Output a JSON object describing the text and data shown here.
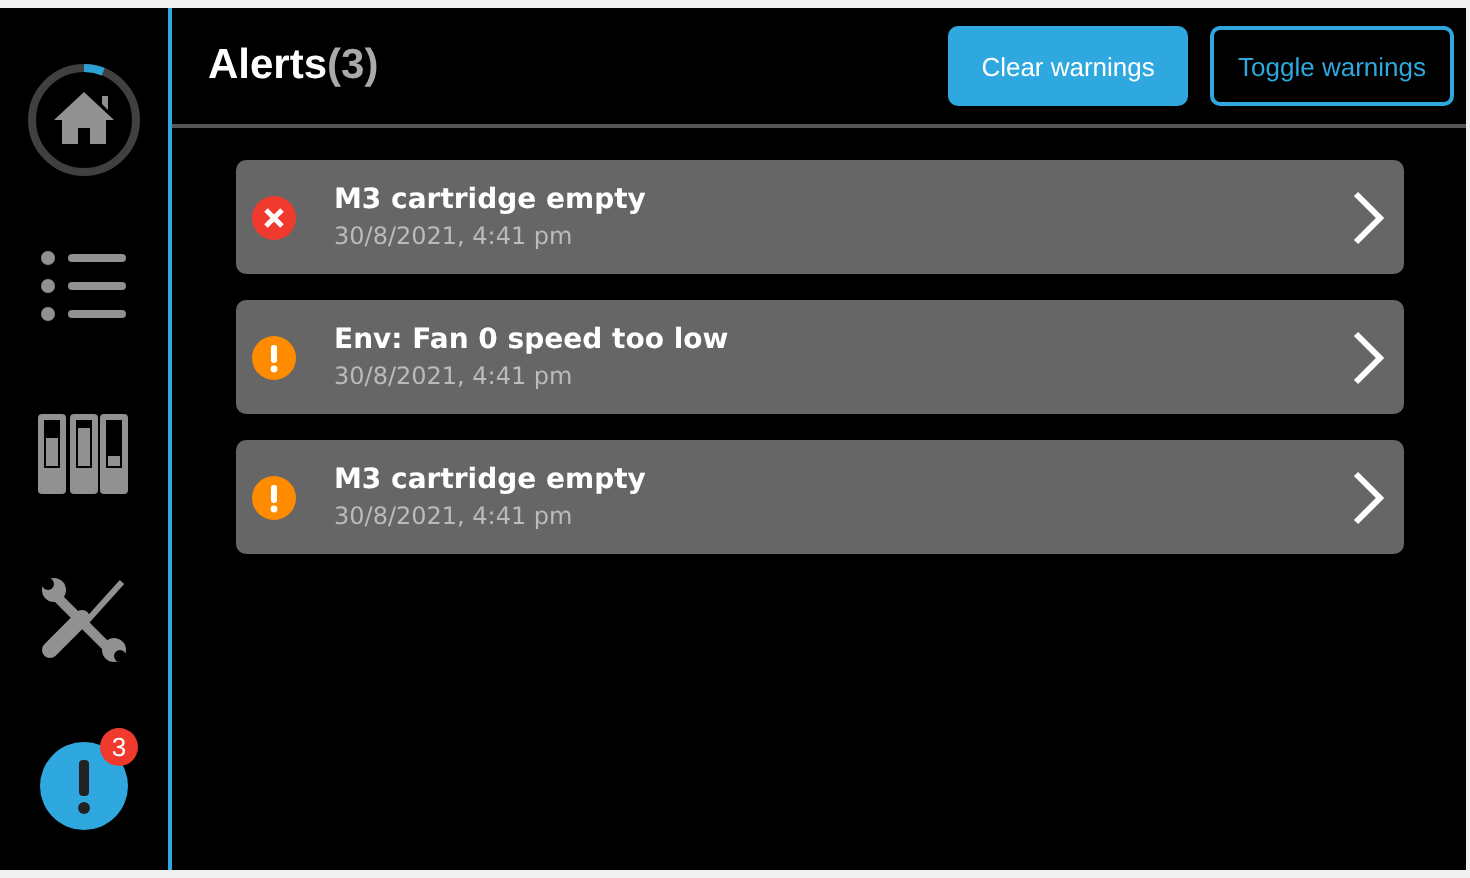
{
  "sidebar": {
    "items": [
      {
        "kind": "home",
        "selected": false
      },
      {
        "kind": "list",
        "selected": false
      },
      {
        "kind": "cartridges",
        "selected": false
      },
      {
        "kind": "tools",
        "selected": false
      },
      {
        "kind": "alerts",
        "selected": true,
        "badge": "3"
      }
    ]
  },
  "header": {
    "title": "Alerts",
    "count": "(3)",
    "buttons": [
      {
        "label": "Clear warnings",
        "kind": "filled"
      },
      {
        "label": "Toggle warnings",
        "kind": "outline"
      }
    ]
  },
  "alerts": [
    {
      "kind": "error",
      "title": "M3 cartridge empty",
      "time": "30/8/2021, 4:41 pm"
    },
    {
      "kind": "warning",
      "title": "Env: Fan 0 speed too low",
      "time": "30/8/2021, 4:41 pm"
    },
    {
      "kind": "warning",
      "title": "M3 cartridge empty",
      "time": "30/8/2021, 4:41 pm"
    }
  ]
}
